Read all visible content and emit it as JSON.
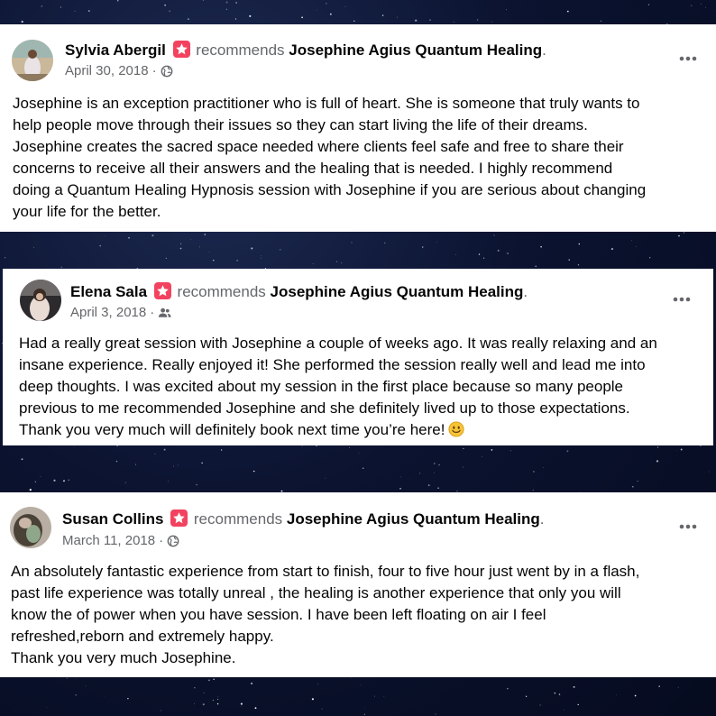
{
  "reviews": [
    {
      "author": "Sylvia Abergil",
      "action": "recommends",
      "page": "Josephine Agius Quantum Healing",
      "date": "April 30, 2018",
      "privacy": "globe-icon",
      "lines": [
        "Josephine is an exception practitioner who is full of heart.  She is someone that truly wants to",
        "help people move through their issues so they can start living the life of their dreams.",
        "Josephine creates the sacred space needed where clients feel safe and free to share their",
        "concerns to receive all their answers and the healing that is needed.  I highly recommend",
        "doing a Quantum Healing Hypnosis session with Josephine if you are serious about changing",
        "your life for the better."
      ]
    },
    {
      "author": "Elena Sala",
      "action": "recommends",
      "page": "Josephine Agius Quantum Healing",
      "date": "April 3, 2018",
      "privacy": "friends-icon",
      "lines": [
        "Had a really great session with Josephine a couple of weeks ago. It was really relaxing and an",
        "insane experience. Really enjoyed it! She performed the session really well and lead me into",
        "deep thoughts. I was excited about my session in the first place because so many people",
        "previous to me recommended Josephine and she definitely lived up to those expectations.",
        "Thank you very much will definitely book next time you’re here!"
      ],
      "emoji": "smiling-face-icon"
    },
    {
      "author": "Susan Collins",
      "action": "recommends",
      "page": "Josephine Agius Quantum Healing",
      "date": "March 11, 2018",
      "privacy": "globe-icon",
      "lines": [
        "An absolutely fantastic experience from start to finish, four to five hour just went by in a flash,",
        "past life experience was totally unreal , the healing is another experience that only you will",
        "know the of  power when you have session. I have been left floating on air I  feel",
        "refreshed,reborn and extremely happy.",
        "Thank you very much Josephine."
      ]
    }
  ],
  "colors": {
    "badge": "#f3425f",
    "secondary_text": "#65676b",
    "primary_text": "#050505",
    "background": "#0b1330"
  }
}
